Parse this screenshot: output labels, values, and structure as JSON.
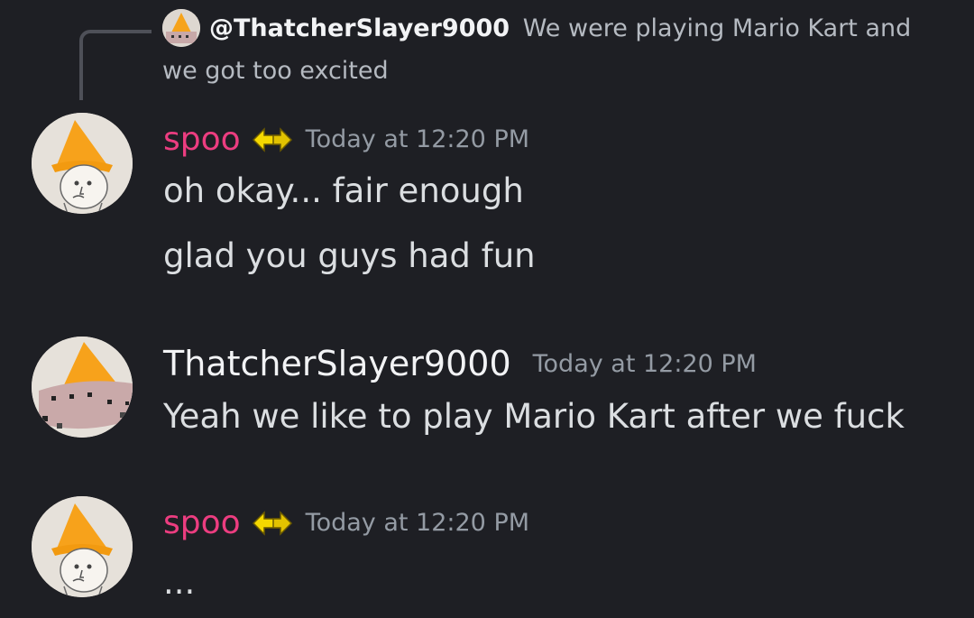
{
  "reply": {
    "author": "@ThatcherSlayer9000",
    "text_line1": "We were playing Mario Kart and",
    "text_line2": "we got too excited"
  },
  "messages": [
    {
      "author": "spoo",
      "timestamp": "Today at 12:20 PM",
      "lines": [
        "oh okay... fair enough",
        "glad you guys had fun"
      ]
    },
    {
      "author": "ThatcherSlayer9000",
      "timestamp": "Today at 12:20 PM",
      "lines": [
        "Yeah we like to play Mario Kart after we fuck"
      ]
    },
    {
      "author": "spoo",
      "timestamp": "Today at 12:20 PM",
      "lines": [
        "..."
      ]
    }
  ],
  "colors": {
    "background": "#1e1f24",
    "spoo_name": "#ec3d80",
    "timestamp": "#949ba4",
    "message_text": "#dbdee1",
    "badge": "#f5d800"
  },
  "icons": {
    "role_badge": "swap-arrows-icon",
    "avatar_spoo": "gnome-hat-avatar",
    "avatar_thatcher": "cone-hat-avatar"
  }
}
